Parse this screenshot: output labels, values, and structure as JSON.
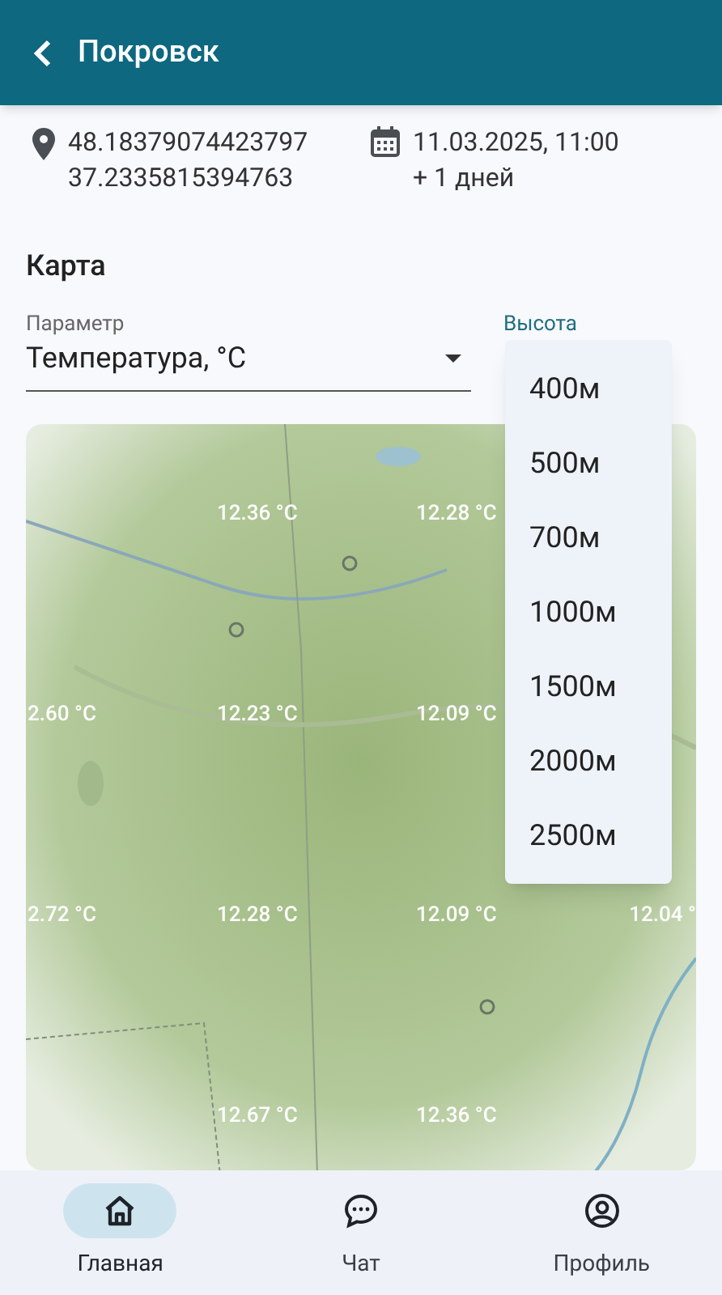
{
  "header": {
    "title": "Покровск"
  },
  "location": {
    "latitude": "48.18379074423797",
    "longitude": "37.2335815394763"
  },
  "date": {
    "value": "11.03.2025, 11:00",
    "offset": "+ 1 дней"
  },
  "section_title": "Карта",
  "parameter_field": {
    "label": "Параметр",
    "value": "Температура, °C"
  },
  "height_field": {
    "label": "Высота"
  },
  "height_menu": [
    {
      "label": "400м"
    },
    {
      "label": "500м"
    },
    {
      "label": "700м"
    },
    {
      "label": "1000м"
    },
    {
      "label": "1500м"
    },
    {
      "label": "2000м"
    },
    {
      "label": "2500м"
    }
  ],
  "map_labels": [
    {
      "column_2": "12.36 °C",
      "column_3": "12.28 °C"
    },
    {
      "column_1": "2.60 °C",
      "column_2": "12.23 °C",
      "column_3": "12.09 °C"
    },
    {
      "column_1": "2.72 °C",
      "column_2": "12.28 °C",
      "column_3": "12.09 °C",
      "column_4": "12.04 °"
    },
    {
      "column_2": "12.67 °C",
      "column_3": "12.36 °C"
    }
  ],
  "nav": [
    {
      "kind": "home",
      "label": "Главная",
      "selected": true
    },
    {
      "kind": "chat",
      "label": "Чат",
      "selected": false
    },
    {
      "kind": "profile",
      "label": "Профиль",
      "selected": false
    }
  ]
}
